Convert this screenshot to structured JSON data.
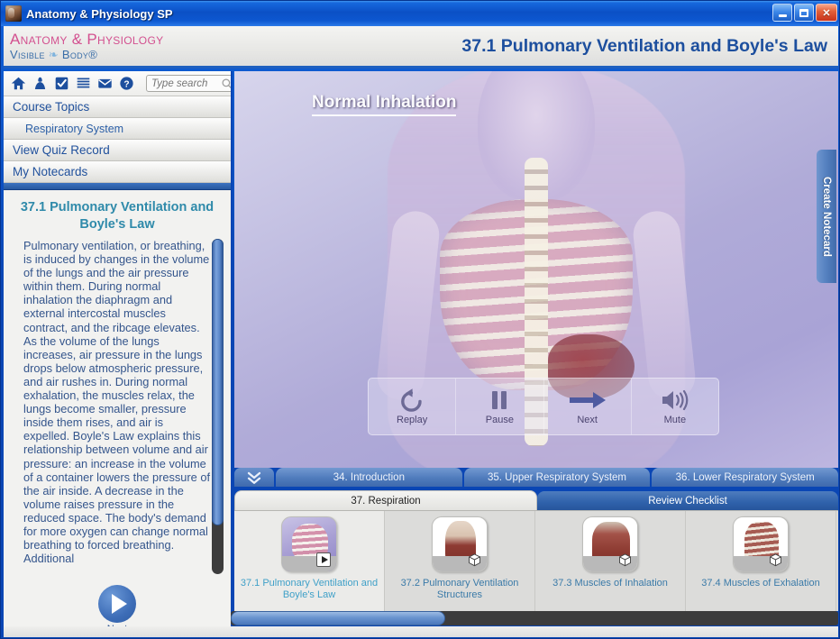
{
  "window": {
    "title": "Anatomy & Physiology SP",
    "icon": "app-icon",
    "buttons": {
      "minimize": "_",
      "maximize": "□",
      "close": "✕"
    }
  },
  "header": {
    "logo_line1": "Anatomy & Physiology",
    "logo_line2_a": "Visible",
    "logo_line2_b": "Body",
    "logo_line2_mark": "®",
    "chapter_title": "37.1 Pulmonary Ventilation and Boyle's Law",
    "logo_color_primary": "#d3508f",
    "logo_color_secondary": "#3a6ea8",
    "title_color": "#1d4f9e"
  },
  "toolbar": {
    "icons": [
      {
        "name": "home-icon",
        "label": "Home"
      },
      {
        "name": "person-icon",
        "label": "Person"
      },
      {
        "name": "checkbox-icon",
        "label": "Quiz"
      },
      {
        "name": "list-icon",
        "label": "List"
      },
      {
        "name": "mail-icon",
        "label": "Mail"
      },
      {
        "name": "help-icon",
        "label": "Help"
      }
    ],
    "search_placeholder": "Type search",
    "search_value": ""
  },
  "sidebar": {
    "nav_items": [
      {
        "label": "Course Topics",
        "sub": false
      },
      {
        "label": "Respiratory System",
        "sub": true
      },
      {
        "label": "View Quiz Record",
        "sub": false
      },
      {
        "label": "My Notecards",
        "sub": false
      }
    ],
    "lesson_title": "37.1 Pulmonary Ventilation and Boyle's Law",
    "lesson_body": "Pulmonary ventilation, or breathing, is induced by changes in the volume of the lungs and the air pressure within them. During normal inhalation the diaphragm and external intercostal muscles contract, and the ribcage elevates. As the volume of the lungs increases, air pressure in the lungs drops below atmospheric pressure, and air rushes in. During normal exhalation, the muscles relax, the lungs become smaller, pressure inside them rises, and air is expelled. Boyle's Law explains this relationship between volume and air pressure: an increase in the volume of a container lowers the pressure of the air inside. A decrease in the volume raises pressure in the reduced space. The body's demand for more oxygen can change normal breathing to forced breathing. Additional",
    "next_label": "Next",
    "lesson_title_color": "#2f8aaa",
    "lesson_body_color": "#34558c"
  },
  "viewer": {
    "label": "Normal Inhalation",
    "player": [
      {
        "name": "replay-button",
        "label": "Replay",
        "icon": "replay-icon"
      },
      {
        "name": "pause-button",
        "label": "Pause",
        "icon": "pause-icon"
      },
      {
        "name": "next-button",
        "label": "Next",
        "icon": "arrow-right-icon"
      },
      {
        "name": "mute-button",
        "label": "Mute",
        "icon": "speaker-icon"
      }
    ]
  },
  "notecard_tab": {
    "label": "Create Notecard"
  },
  "tabs": {
    "chevron": "chevron-double-down-icon",
    "top": [
      {
        "label": "34. Introduction",
        "active": false
      },
      {
        "label": "35. Upper Respiratory System",
        "active": false
      },
      {
        "label": "36. Lower Respiratory System",
        "active": false
      }
    ],
    "bottom": [
      {
        "label": "37. Respiration",
        "active": true
      },
      {
        "label": "Review Checklist",
        "active": false
      }
    ]
  },
  "thumbnails": [
    {
      "label": "37.1 Pulmonary Ventilation and Boyle's Law",
      "badge": "play",
      "active": true
    },
    {
      "label": "37.2 Pulmonary Ventilation Structures",
      "badge": "cube",
      "active": false
    },
    {
      "label": "37.3 Muscles of Inhalation",
      "badge": "cube",
      "active": false
    },
    {
      "label": "37.4 Muscles of Exhalation",
      "badge": "cube",
      "active": false
    }
  ]
}
